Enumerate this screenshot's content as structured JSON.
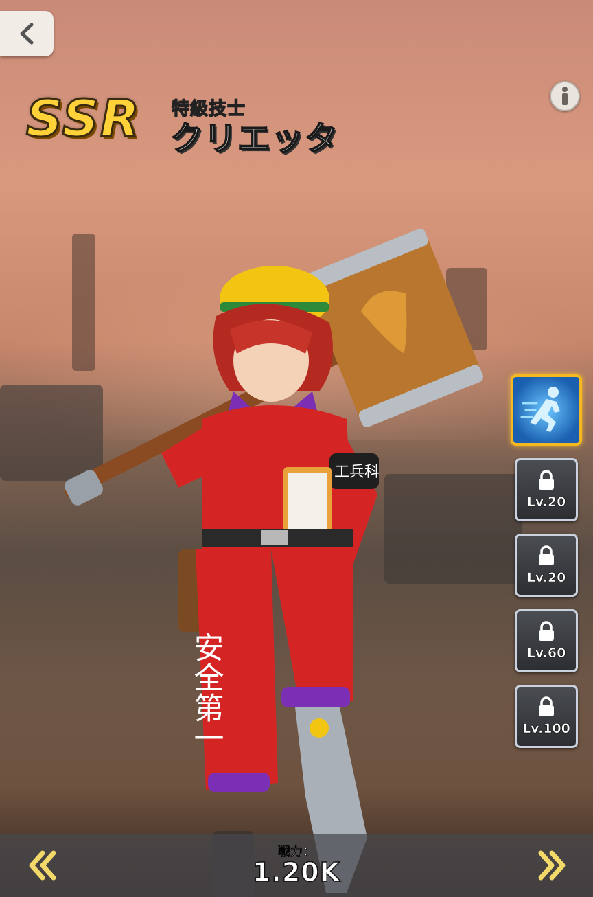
{
  "header": {
    "rarity": "SSR",
    "subtitle": "特級技士",
    "name": "クリエッタ"
  },
  "character_name_armband": "工兵科",
  "character_pants_text": "安全第一",
  "skills": [
    {
      "type": "active",
      "icon": "running-figure-icon",
      "level_label": ""
    },
    {
      "type": "locked",
      "icon": "lock-icon",
      "level_label": "Lv.20"
    },
    {
      "type": "locked",
      "icon": "lock-icon",
      "level_label": "Lv.20"
    },
    {
      "type": "locked",
      "icon": "lock-icon",
      "level_label": "Lv.60"
    },
    {
      "type": "locked",
      "icon": "lock-icon",
      "level_label": "Lv.100"
    }
  ],
  "footer": {
    "power_label": "戦力：",
    "power_value": "1.20K"
  },
  "colors": {
    "rarity_gold": "#ffd23a",
    "skill_active_border": "#f6b820",
    "skill_locked_border": "#c9d2de"
  }
}
